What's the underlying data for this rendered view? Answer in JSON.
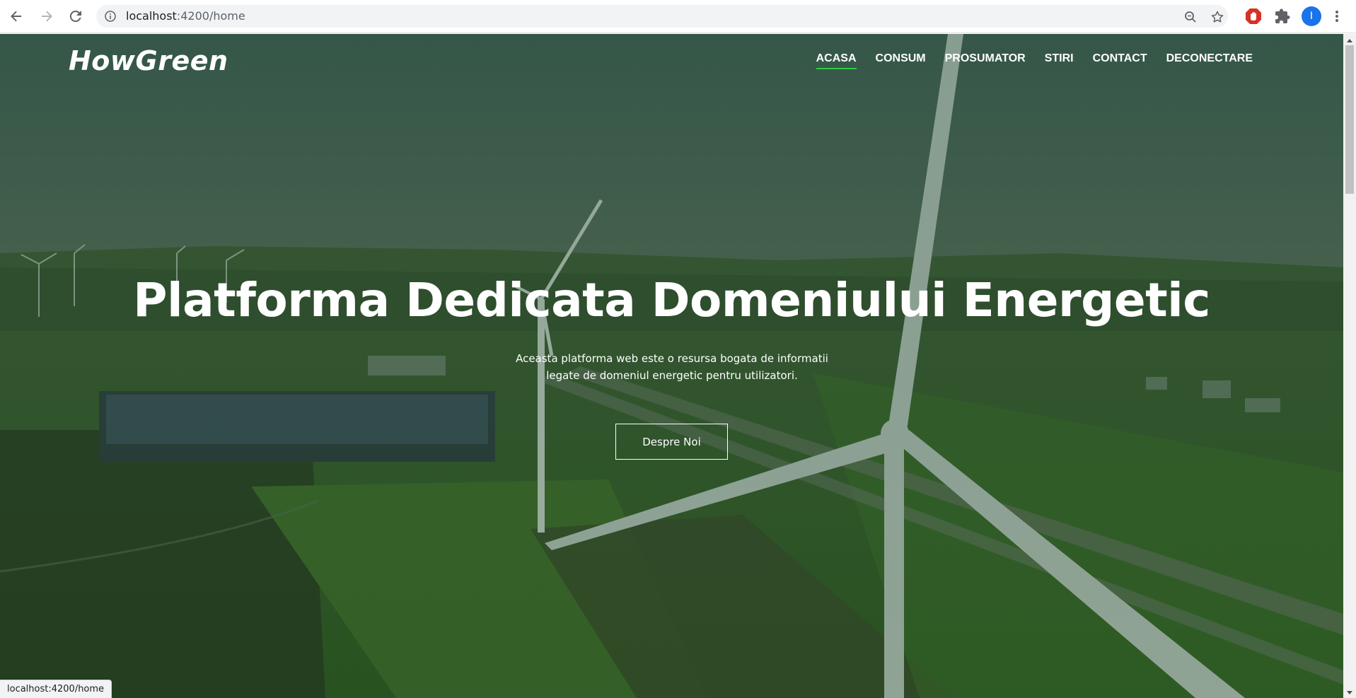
{
  "browser": {
    "url_host": "localhost",
    "url_path": ":4200/home",
    "profile_initial": "I",
    "colors": {
      "profile": "#1a73e8",
      "adblock": "#d93025"
    }
  },
  "site": {
    "logo": "HowGreen",
    "nav": [
      {
        "label": "ACASA",
        "active": true
      },
      {
        "label": "CONSUM",
        "active": false
      },
      {
        "label": "PROSUMATOR",
        "active": false
      },
      {
        "label": "STIRI",
        "active": false
      },
      {
        "label": "CONTACT",
        "active": false
      },
      {
        "label": "DECONECTARE",
        "active": false
      }
    ],
    "accent_color": "#2ecc40"
  },
  "hero": {
    "title": "Platforma Dedicata Domeniului Energetic",
    "subtitle_line1": "Aceasta platforma web este o resursa bogata de informatii",
    "subtitle_line2": "legate de domeniul energetic pentru utilizatori.",
    "button_label": "Despre Noi"
  },
  "status_bar": {
    "text": "localhost:4200/home"
  },
  "icons": [
    "back-arrow-icon",
    "forward-arrow-icon",
    "reload-icon",
    "info-icon",
    "zoom-icon",
    "star-icon",
    "adblock-icon",
    "extensions-icon",
    "profile-avatar",
    "kebab-menu-icon"
  ]
}
